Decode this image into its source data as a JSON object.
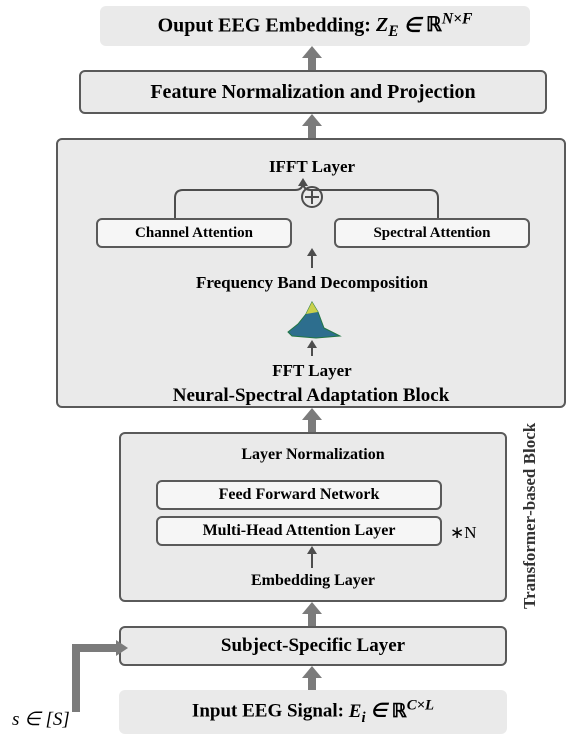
{
  "output": {
    "label_prefix": "Ouput EEG Embedding: ",
    "symbol": "Z_E",
    "space": "ℝ^{N×F}"
  },
  "featnorm": {
    "label": "Feature Normalization and Projection"
  },
  "adapt": {
    "title": "Neural‑Spectral Adaptation Block",
    "ifft": "IFFT Layer",
    "channel_attn": "Channel Attention",
    "spectral_attn": "Spectral Attention",
    "freq_decomp": "Frequency Band Decomposition",
    "fft": "FFT Layer"
  },
  "transformer": {
    "side_label": "Transformer‑based Block",
    "embedding": "Embedding Layer",
    "ln_label": "Layer Normalization",
    "ffn": "Feed Forward Network",
    "mha": "Multi‑Head Attention Layer",
    "repeat": "∗N"
  },
  "subject_layer": {
    "label": "Subject‑Specific Layer"
  },
  "input": {
    "label_prefix": "Input EEG Signal:  ",
    "symbol": "E_i",
    "space": "ℝ^{C×L}"
  },
  "s_label": {
    "prefix": "s ∈ [",
    "S": "S",
    "suffix": "]"
  }
}
